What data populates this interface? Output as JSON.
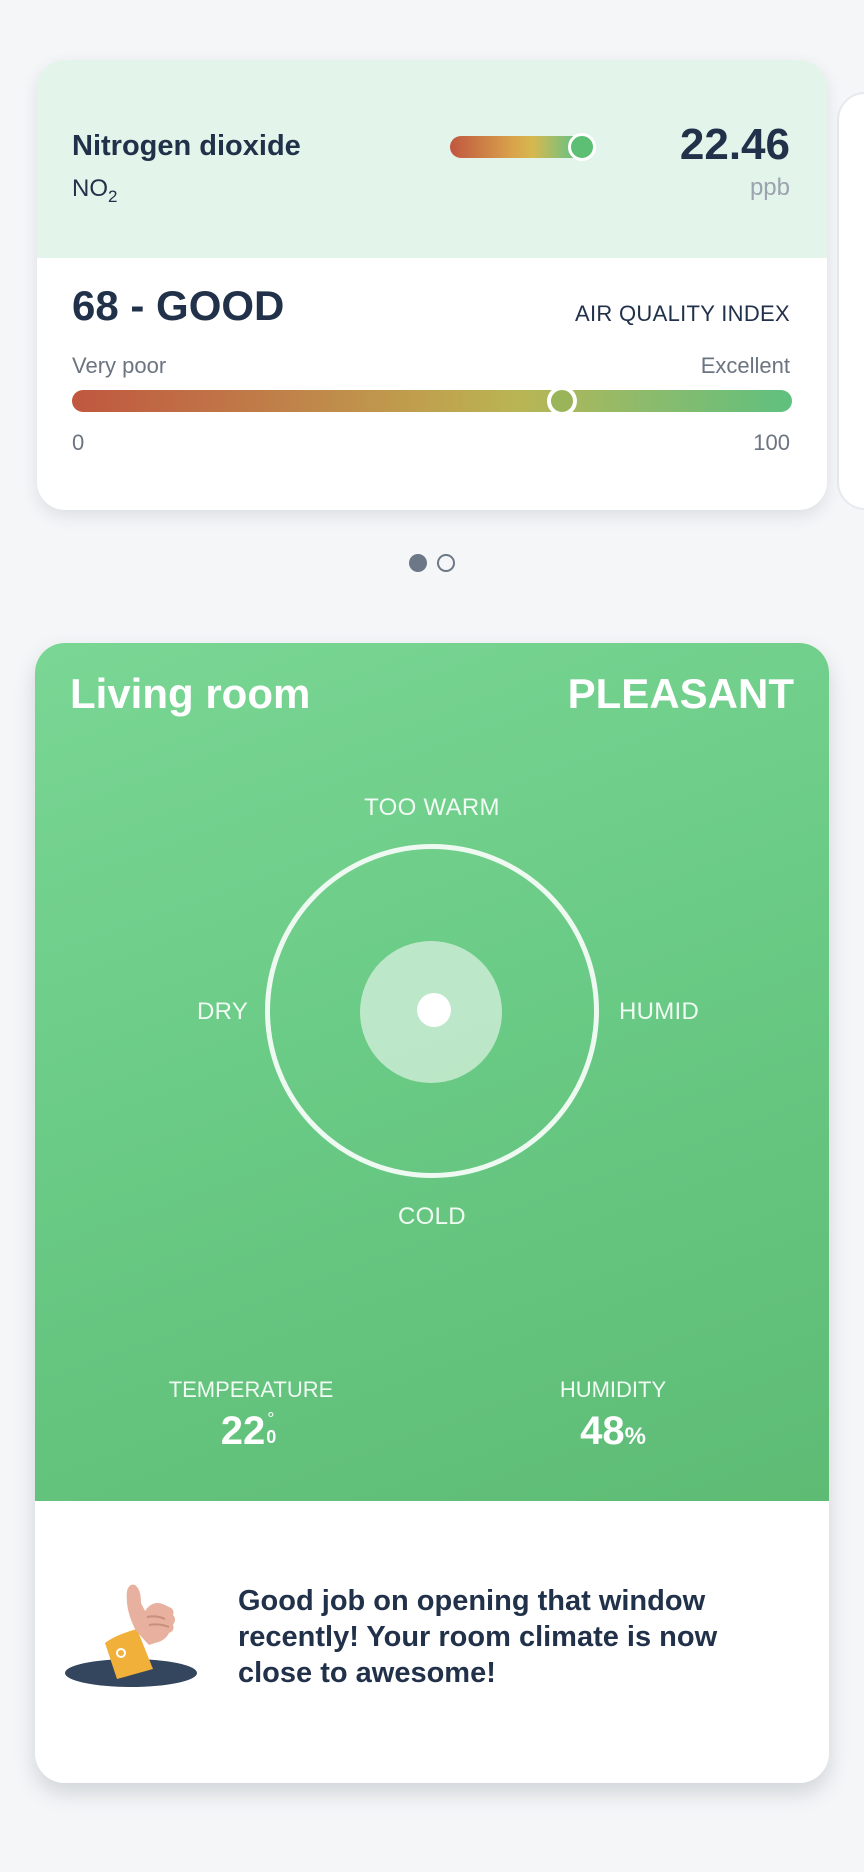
{
  "air_quality": {
    "pollutant": {
      "name": "Nitrogen dioxide",
      "formula_base": "NO",
      "formula_subscript": "2",
      "value": "22.46",
      "unit": "ppb",
      "level_fraction": 0.9
    },
    "index": {
      "headline": "68 - GOOD",
      "label": "AIR QUALITY INDEX",
      "scale_low_label": "Very poor",
      "scale_high_label": "Excellent",
      "min": "0",
      "max": "100",
      "value": 68
    }
  },
  "pager": {
    "count": 2,
    "active_index": 0
  },
  "room": {
    "name": "Living room",
    "status": "PLEASANT",
    "comfort_labels": {
      "top": "TOO WARM",
      "bottom": "COLD",
      "left": "DRY",
      "right": "HUMID"
    },
    "temperature": {
      "label": "TEMPERATURE",
      "value": "22",
      "decimal": "0",
      "degree": "°"
    },
    "humidity": {
      "label": "HUMIDITY",
      "value": "48",
      "unit": "%"
    },
    "tip": "Good job on opening that window recently! Your room climate is now close to awesome!"
  },
  "colors": {
    "background": "#f5f6f8",
    "card_green_top": "#7ad694",
    "card_green_bottom": "#5dbb74",
    "text_dark": "#22314a",
    "pollutant_bg": "#e3f4ea"
  }
}
